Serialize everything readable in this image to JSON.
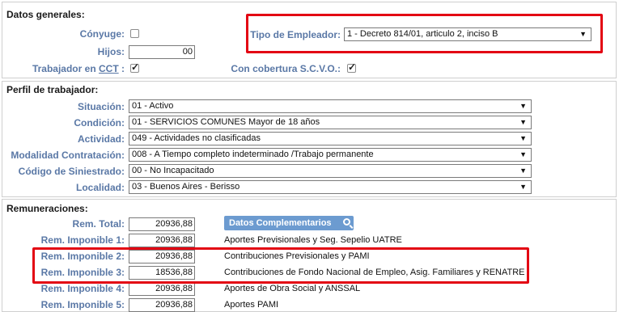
{
  "datos_generales": {
    "title": "Datos generales:",
    "conyuge_label": "Cónyuge:",
    "conyuge_checked": false,
    "hijos_label": "Hijos:",
    "hijos_value": "00",
    "trabajador_prefix": "Trabajador en ",
    "trabajador_link": "CCT",
    "trabajador_suffix": " :",
    "trabajador_checked": true,
    "tipo_empleador_label": "Tipo de Empleador:",
    "tipo_empleador_value": "1 - Decreto 814/01, articulo 2, inciso B",
    "svo_label": "Con cobertura S.C.V.O.:",
    "svo_checked": true
  },
  "perfil": {
    "title": "Perfil de trabajador:",
    "fields": [
      {
        "label": "Situación:",
        "value": "01 - Activo"
      },
      {
        "label": "Condición:",
        "value": "01 - SERVICIOS COMUNES Mayor de 18 años"
      },
      {
        "label": "Actividad:",
        "value": "049 - Actividades no clasificadas"
      },
      {
        "label": "Modalidad Contratación:",
        "value": "008 - A Tiempo completo indeterminado /Trabajo permanente"
      },
      {
        "label": "Código de Siniestrado:",
        "value": "00 - No Incapacitado"
      },
      {
        "label": "Localidad:",
        "value": "03 - Buenos Aires - Berisso"
      }
    ]
  },
  "remuneraciones": {
    "title": "Remuneraciones:",
    "button_label": "Datos Complementarios",
    "rows": [
      {
        "label": "Rem. Total:",
        "value": "20936,88",
        "desc": ""
      },
      {
        "label": "Rem. Imponible 1:",
        "value": "20936,88",
        "desc": "Aportes Previsionales y Seg. Sepelio UATRE"
      },
      {
        "label": "Rem. Imponible 2:",
        "value": "20936,88",
        "desc": "Contribuciones Previsionales y PAMI"
      },
      {
        "label": "Rem. Imponible 3:",
        "value": "18536,88",
        "desc": "Contribuciones de Fondo Nacional de Empleo, Asig. Familiares y RENATRE"
      },
      {
        "label": "Rem. Imponible 4:",
        "value": "20936,88",
        "desc": "Aportes de Obra Social y ANSSAL"
      },
      {
        "label": "Rem. Imponible 5:",
        "value": "20936,88",
        "desc": "Aportes PAMI"
      }
    ]
  },
  "colors": {
    "label": "#5a78a6",
    "highlight": "#e30613",
    "button": "#6c9bd0"
  }
}
